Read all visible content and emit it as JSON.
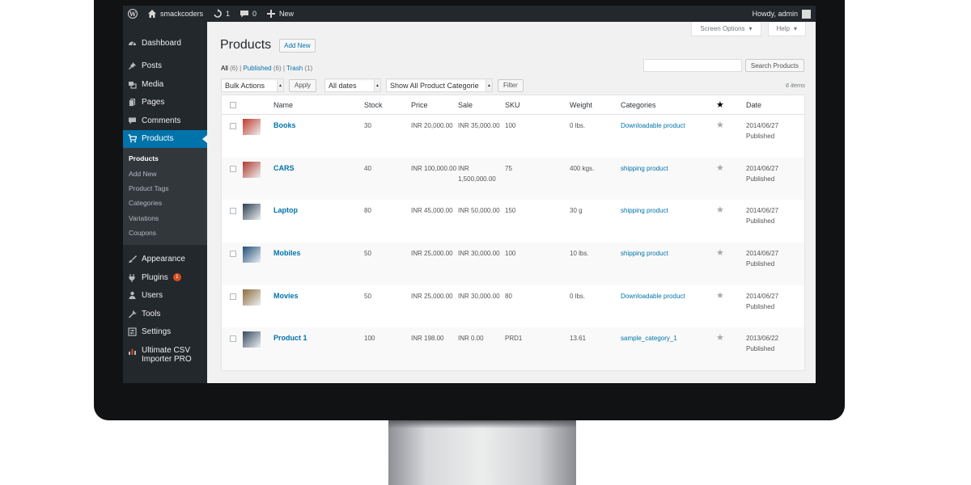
{
  "adminbar": {
    "site_name": "smackcoders",
    "updates_count": "1",
    "comments_count": "0",
    "new_label": "New",
    "greeting": "Howdy, admin"
  },
  "sidebar": {
    "items": [
      {
        "label": "Dashboard",
        "icon": "dashboard-icon"
      },
      {
        "label": "Posts",
        "icon": "pin-icon"
      },
      {
        "label": "Media",
        "icon": "media-icon"
      },
      {
        "label": "Pages",
        "icon": "pages-icon"
      },
      {
        "label": "Comments",
        "icon": "comment-icon"
      },
      {
        "label": "Products",
        "icon": "cart-icon"
      }
    ],
    "submenu": [
      "Products",
      "Add New",
      "Product Tags",
      "Categories",
      "Variations",
      "Coupons"
    ],
    "items_after": [
      {
        "label": "Appearance",
        "icon": "brush-icon"
      },
      {
        "label": "Plugins",
        "icon": "plugin-icon",
        "badge": "1"
      },
      {
        "label": "Users",
        "icon": "users-icon"
      },
      {
        "label": "Tools",
        "icon": "wrench-icon"
      },
      {
        "label": "Settings",
        "icon": "settings-icon"
      },
      {
        "label": "Ultimate CSV Importer PRO",
        "icon": "chart-icon"
      }
    ]
  },
  "screen_meta": {
    "screen_options": "Screen Options",
    "help": "Help"
  },
  "page": {
    "title": "Products",
    "add_new": "Add New",
    "filters": {
      "all": "All",
      "all_count": "(6)",
      "published": "Published",
      "published_count": "(6)",
      "trash": "Trash",
      "trash_count": "(1)",
      "sep": "|"
    },
    "search_button": "Search Products",
    "bulk_actions": "Bulk Actions",
    "apply": "Apply",
    "all_dates": "All dates",
    "category_filter": "Show All Product Categorie",
    "filter": "Filter",
    "items_count": "6 items"
  },
  "table": {
    "headers": [
      "Name",
      "Stock",
      "Price",
      "Sale",
      "SKU",
      "Weight",
      "Categories",
      "Date"
    ],
    "rows": [
      {
        "name": "Books",
        "stock": "30",
        "price": "INR 20,000.00",
        "sale": "INR 35,000.00",
        "sku": "100",
        "weight": "0 lbs.",
        "category": "Downloadable product",
        "date": "2014/06/27",
        "status": "Published",
        "thumb_color": "#c0392b"
      },
      {
        "name": "CARS",
        "stock": "40",
        "price": "INR 100,000.00",
        "sale": "INR 1,500,000.00",
        "sku": "75",
        "weight": "400 kgs.",
        "category": "shipping product",
        "date": "2014/06/27",
        "status": "Published",
        "thumb_color": "#b03a2e"
      },
      {
        "name": "Laptop",
        "stock": "80",
        "price": "INR 45,000.00",
        "sale": "INR 50,000.00",
        "sku": "150",
        "weight": "30 g",
        "category": "shipping product",
        "date": "2014/06/27",
        "status": "Published",
        "thumb_color": "#2c3e50"
      },
      {
        "name": "Mobiles",
        "stock": "50",
        "price": "INR 25,000.00",
        "sale": "INR 30,000.00",
        "sku": "100",
        "weight": "10 lbs.",
        "category": "shipping product",
        "date": "2014/06/27",
        "status": "Published",
        "thumb_color": "#1f4e79"
      },
      {
        "name": "Movies",
        "stock": "50",
        "price": "INR 25,000.00",
        "sale": "INR 30,000.00",
        "sku": "80",
        "weight": "0 lbs.",
        "category": "Downloadable product",
        "date": "2014/06/27",
        "status": "Published",
        "thumb_color": "#8e6b3d"
      },
      {
        "name": "Product 1",
        "stock": "100",
        "price": "INR 198.00",
        "sale": "INR 0.00",
        "sku": "PRD1",
        "weight": "13.61",
        "category": "sample_category_1",
        "date": "2013/06/22",
        "status": "Published",
        "thumb_color": "#34495e"
      }
    ]
  },
  "colors": {
    "admin_dark": "#23282d",
    "accent": "#0073aa",
    "submenu_bg": "#32373c",
    "badge": "#d54e21"
  }
}
